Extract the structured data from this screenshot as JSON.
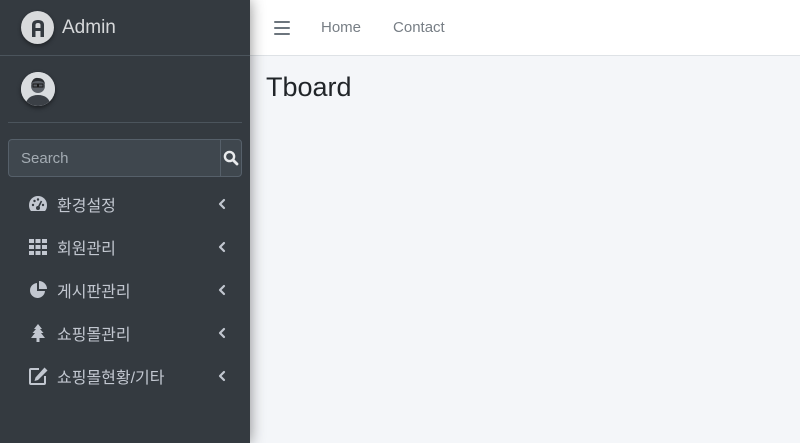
{
  "brand": {
    "name": "Admin",
    "logo_letter": "A"
  },
  "search": {
    "placeholder": "Search"
  },
  "sidebar": {
    "items": [
      {
        "label": "환경설정",
        "icon": "dashboard-icon"
      },
      {
        "label": "회원관리",
        "icon": "grid-icon"
      },
      {
        "label": "게시판관리",
        "icon": "pie-chart-icon"
      },
      {
        "label": "쇼핑몰관리",
        "icon": "tree-icon"
      },
      {
        "label": "쇼핑몰현황/기타",
        "icon": "edit-icon"
      }
    ]
  },
  "topbar": {
    "links": [
      {
        "label": "Home"
      },
      {
        "label": "Contact"
      }
    ]
  },
  "main": {
    "title": "Tboard"
  },
  "colors": {
    "sidebar_bg": "#343a40",
    "sidebar_text": "#c2c7d0",
    "content_bg": "#f4f6f9",
    "topbar_bg": "#ffffff"
  }
}
